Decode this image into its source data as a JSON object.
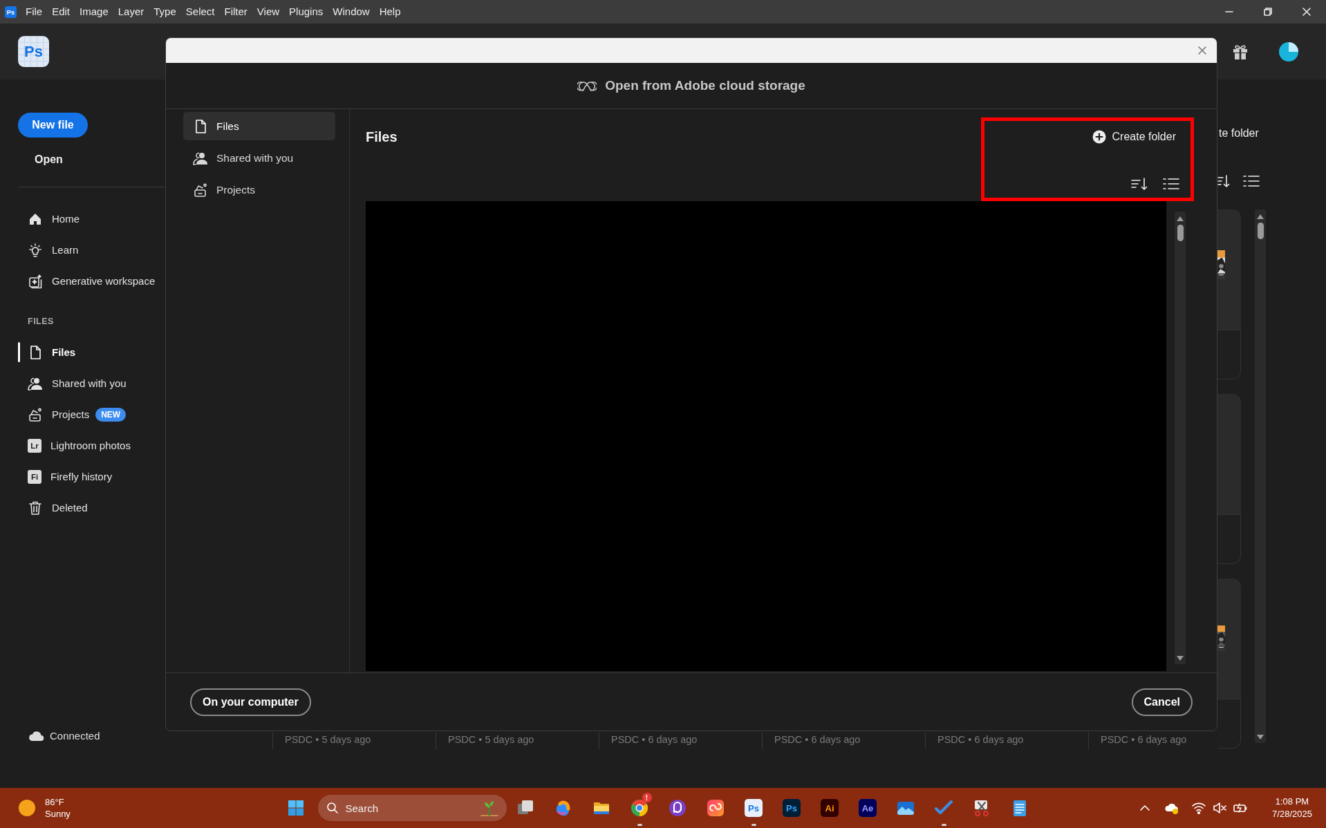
{
  "menu_bar": {
    "logo": "Ps",
    "items": [
      "File",
      "Edit",
      "Image",
      "Layer",
      "Type",
      "Select",
      "Filter",
      "View",
      "Plugins",
      "Window",
      "Help"
    ]
  },
  "header": {
    "logo": "Ps"
  },
  "sidebar": {
    "new_file": "New file",
    "open": "Open",
    "nav": [
      {
        "label": "Home",
        "selected": false
      },
      {
        "label": "Learn",
        "selected": false
      },
      {
        "label": "Generative workspace",
        "selected": false
      }
    ],
    "files_heading": "FILES",
    "files": [
      {
        "label": "Files",
        "selected": true
      },
      {
        "label": "Shared with you",
        "selected": false
      },
      {
        "label": "Projects",
        "selected": false,
        "badge": "NEW"
      },
      {
        "label": "Lightroom photos",
        "selected": false,
        "icon_label": "Lr"
      },
      {
        "label": "Firefly history",
        "selected": false,
        "icon_label": "Fi"
      },
      {
        "label": "Deleted",
        "selected": false
      }
    ],
    "status": "Connected"
  },
  "background": {
    "create_folder": "te folder",
    "captions": [
      "PSDC • 5 days ago",
      "PSDC • 5 days ago",
      "PSDC • 6 days ago",
      "PSDC • 6 days ago",
      "PSDC • 6 days ago",
      "PSDC • 6 days ago"
    ]
  },
  "dialog": {
    "title": "Open from Adobe cloud storage",
    "nav": [
      {
        "label": "Files",
        "selected": true
      },
      {
        "label": "Shared with you",
        "selected": false
      },
      {
        "label": "Projects",
        "selected": false
      }
    ],
    "heading": "Files",
    "create_folder": "Create folder",
    "buttons": [
      "On your computer",
      "Cancel"
    ]
  },
  "taskbar": {
    "weather": {
      "temperature": "86°F",
      "condition": "Sunny"
    },
    "search": {
      "placeholder": "Search"
    },
    "apps": [
      {
        "running": false
      },
      {
        "running": false
      },
      {
        "running": false
      },
      {
        "running": true,
        "badge": "!"
      },
      {
        "running": false
      },
      {
        "running": false
      },
      {
        "running": true,
        "label": "Ps"
      },
      {
        "running": false,
        "label": "Ps"
      },
      {
        "running": false,
        "label": "Ai"
      },
      {
        "running": false,
        "label": "Ae"
      },
      {
        "running": false
      },
      {
        "running": true
      },
      {
        "running": false
      },
      {
        "running": false
      }
    ],
    "clock": {
      "time": "1:08 PM",
      "date": "7/28/2025"
    }
  }
}
